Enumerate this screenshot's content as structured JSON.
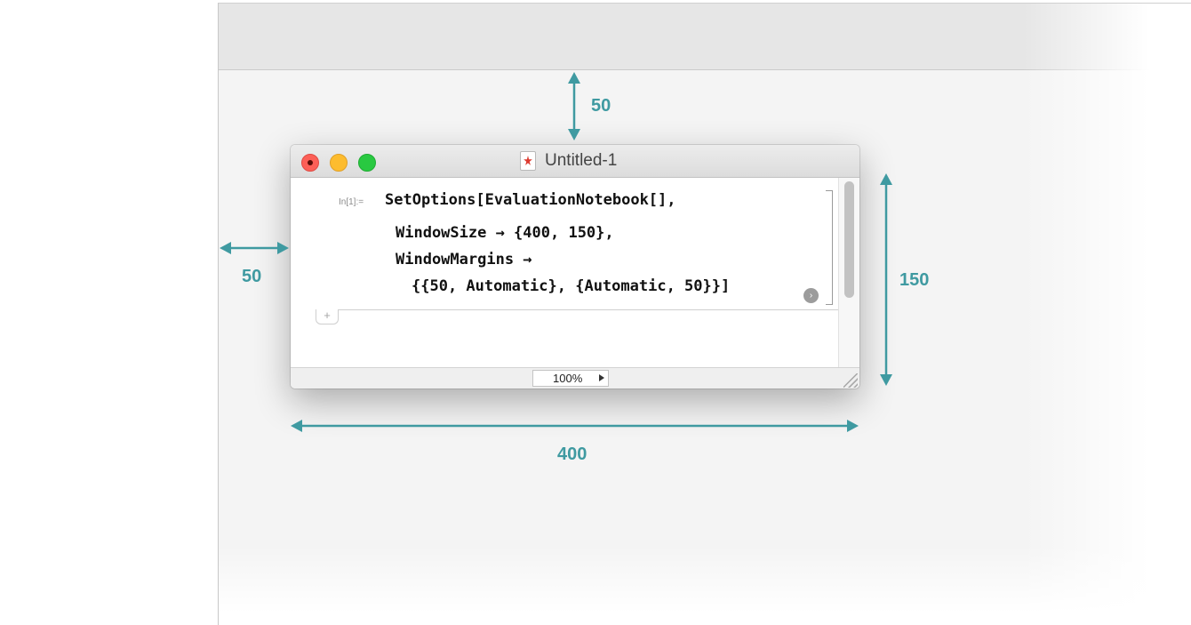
{
  "window": {
    "title": "Untitled-1"
  },
  "notebook": {
    "input_label": "In[1]:=",
    "code_lines": [
      "SetOptions[EvaluationNotebook[],",
      "WindowSize → {400, 150},",
      "WindowMargins →",
      "{{50, Automatic}, {Automatic, 50}}]"
    ],
    "add_cell_glyph": "+",
    "eval_glyph": "›"
  },
  "statusbar": {
    "zoom_value": "100%"
  },
  "annotations": {
    "top_margin": "50",
    "left_margin": "50",
    "window_height": "150",
    "window_width": "400",
    "color": "#3f9aa1"
  },
  "icons": {
    "traffic_lights": [
      "close-icon",
      "minimize-icon",
      "zoom-icon"
    ],
    "document": "mathematica-document-icon",
    "zoom_menu": "triangle-right-icon",
    "resize": "resize-grip-icon"
  },
  "colors": {
    "traffic_close": "#fc5f57",
    "traffic_minimize": "#fdbc2e",
    "traffic_zoom": "#29c941",
    "document_icon": "#dd3a2f"
  }
}
